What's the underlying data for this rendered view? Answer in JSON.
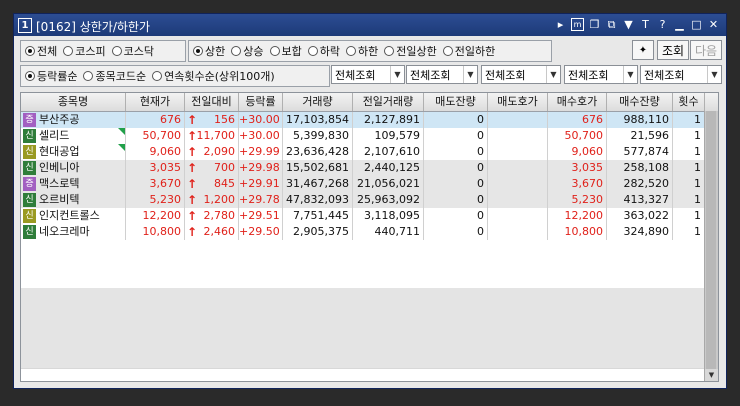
{
  "window": {
    "number": "1",
    "title": "[0162] 상한가/하한가",
    "icons": [
      "arrow-right-icon",
      "m-icon",
      "window-icon",
      "copy-icon",
      "pin-icon",
      "text-icon",
      "help-icon",
      "minimize-icon",
      "maximize-icon",
      "close-icon"
    ]
  },
  "market_filter": {
    "options": [
      "전체",
      "코스피",
      "코스닥"
    ],
    "selected": 0
  },
  "limit_filter": {
    "options": [
      "상한",
      "상승",
      "보합",
      "하락",
      "하한",
      "전일상한",
      "전일하한"
    ],
    "selected": 0
  },
  "toolbar": {
    "query_label": "조회",
    "next_label": "다음"
  },
  "sort_filter": {
    "options": [
      "등락률순",
      "종목코드순",
      "연속횟수순(상위100개)"
    ],
    "selected": 0
  },
  "dropdowns": [
    "전체조회",
    "전체조회",
    "전체조회",
    "전체조회",
    "전체조회"
  ],
  "columns": [
    "종목명",
    "현재가",
    "전일대비",
    "등락률",
    "거래량",
    "전일거래량",
    "매도잔량",
    "매도호가",
    "매수호가",
    "매수잔량",
    "횟수"
  ],
  "rows": [
    {
      "badge": "증",
      "badge_color": "purple",
      "name": "부산주공",
      "price": "676",
      "change": "156",
      "rate": "+30.00",
      "volume": "17,103,854",
      "prev_volume": "2,127,891",
      "ask_qty": "0",
      "ask": "",
      "bid": "676",
      "bid_qty": "988,110",
      "count": "1",
      "flag": false,
      "selected": true
    },
    {
      "badge": "신",
      "badge_color": "green",
      "name": "셀리드",
      "price": "50,700",
      "change": "11,700",
      "rate": "+30.00",
      "volume": "5,399,830",
      "prev_volume": "109,579",
      "ask_qty": "0",
      "ask": "",
      "bid": "50,700",
      "bid_qty": "21,596",
      "count": "1",
      "flag": true,
      "selected": false
    },
    {
      "badge": "신",
      "badge_color": "olive",
      "name": "현대공업",
      "price": "9,060",
      "change": "2,090",
      "rate": "+29.99",
      "volume": "23,636,428",
      "prev_volume": "2,107,610",
      "ask_qty": "0",
      "ask": "",
      "bid": "9,060",
      "bid_qty": "577,874",
      "count": "1",
      "flag": true,
      "selected": false
    },
    {
      "badge": "신",
      "badge_color": "green",
      "name": "인베니아",
      "price": "3,035",
      "change": "700",
      "rate": "+29.98",
      "volume": "15,502,681",
      "prev_volume": "2,440,125",
      "ask_qty": "0",
      "ask": "",
      "bid": "3,035",
      "bid_qty": "258,108",
      "count": "1",
      "flag": false,
      "selected": false
    },
    {
      "badge": "증",
      "badge_color": "purple",
      "name": "맥스로텍",
      "price": "3,670",
      "change": "845",
      "rate": "+29.91",
      "volume": "31,467,268",
      "prev_volume": "21,056,021",
      "ask_qty": "0",
      "ask": "",
      "bid": "3,670",
      "bid_qty": "282,520",
      "count": "1",
      "flag": false,
      "selected": false
    },
    {
      "badge": "신",
      "badge_color": "green",
      "name": "오르비텍",
      "price": "5,230",
      "change": "1,200",
      "rate": "+29.78",
      "volume": "47,832,093",
      "prev_volume": "25,963,092",
      "ask_qty": "0",
      "ask": "",
      "bid": "5,230",
      "bid_qty": "413,327",
      "count": "1",
      "flag": false,
      "selected": false
    },
    {
      "badge": "신",
      "badge_color": "olive",
      "name": "인지컨트롤스",
      "price": "12,200",
      "change": "2,780",
      "rate": "+29.51",
      "volume": "7,751,445",
      "prev_volume": "3,118,095",
      "ask_qty": "0",
      "ask": "",
      "bid": "12,200",
      "bid_qty": "363,022",
      "count": "1",
      "flag": false,
      "selected": false
    },
    {
      "badge": "신",
      "badge_color": "green",
      "name": "네오크레마",
      "price": "10,800",
      "change": "2,460",
      "rate": "+29.50",
      "volume": "2,905,375",
      "prev_volume": "440,711",
      "ask_qty": "0",
      "ask": "",
      "bid": "10,800",
      "bid_qty": "324,890",
      "count": "1",
      "flag": false,
      "selected": false
    }
  ],
  "colors": {
    "titlebar": "#1d3a78",
    "up_red": "#e0211a",
    "selected_row": "#cfe6f5",
    "shade_row": "#e6e6e6"
  }
}
